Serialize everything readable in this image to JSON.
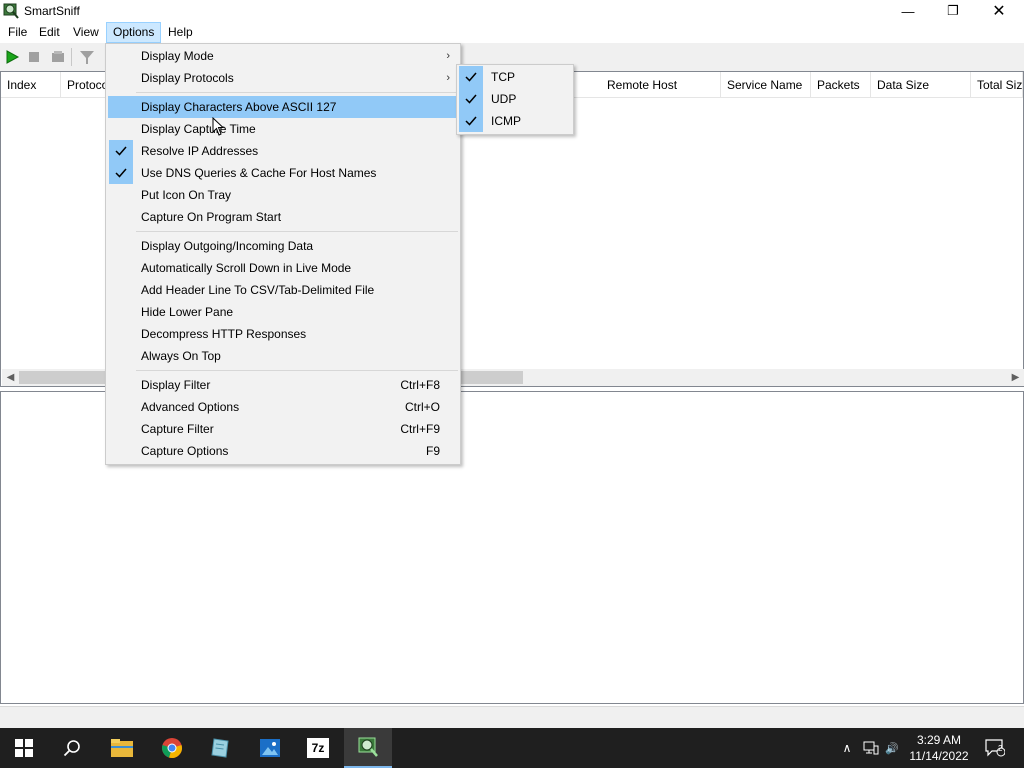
{
  "window": {
    "title": "SmartSniff",
    "minimize_glyph": "—",
    "maximize_glyph": "❐",
    "close_glyph": "✕"
  },
  "menubar": {
    "items": [
      "File",
      "Edit",
      "View",
      "Options",
      "Help"
    ],
    "active": "Options"
  },
  "toolbar": {
    "icons": [
      "play-icon",
      "stop-icon",
      "clear-icon",
      "filter-icon"
    ]
  },
  "columns": [
    {
      "label": "Index"
    },
    {
      "label": "Protocol"
    },
    {
      "label": "Remote Host"
    },
    {
      "label": "Service Name"
    },
    {
      "label": "Packets"
    },
    {
      "label": "Data Size"
    },
    {
      "label": "Total Size"
    }
  ],
  "options_menu": {
    "group1": [
      {
        "label": "Display Mode",
        "has_submenu": true
      },
      {
        "label": "Display Protocols",
        "has_submenu": true
      }
    ],
    "group2": [
      {
        "label": "Display Characters Above ASCII 127",
        "highlighted": true,
        "checked": false
      },
      {
        "label": "Display Capture Time",
        "checked": false
      },
      {
        "label": "Resolve IP Addresses",
        "checked": true
      },
      {
        "label": "Use DNS Queries & Cache For Host Names",
        "checked": true
      },
      {
        "label": "Put Icon On Tray",
        "checked": false
      },
      {
        "label": "Capture On Program Start",
        "checked": false
      }
    ],
    "group3": [
      {
        "label": "Display Outgoing/Incoming Data"
      },
      {
        "label": "Automatically Scroll Down in Live Mode"
      },
      {
        "label": "Add Header Line To CSV/Tab-Delimited File"
      },
      {
        "label": "Hide Lower Pane"
      },
      {
        "label": "Decompress HTTP Responses"
      },
      {
        "label": "Always On Top"
      }
    ],
    "group4": [
      {
        "label": "Display Filter",
        "shortcut": "Ctrl+F8"
      },
      {
        "label": "Advanced Options",
        "shortcut": "Ctrl+O"
      },
      {
        "label": "Capture Filter",
        "shortcut": "Ctrl+F9"
      },
      {
        "label": "Capture Options",
        "shortcut": "F9"
      }
    ]
  },
  "protocols_submenu": [
    {
      "label": "TCP",
      "checked": true
    },
    {
      "label": "UDP",
      "checked": true
    },
    {
      "label": "ICMP",
      "checked": true
    }
  ],
  "taskbar": {
    "apps": [
      "start-icon",
      "search-icon",
      "file-explorer-icon",
      "chrome-icon",
      "notepad-icon",
      "photos-icon",
      "7zip-icon",
      "smartsniff-icon"
    ],
    "active_app": "smartsniff-icon",
    "seven_zip_label": "7z",
    "tray_chevron": "∧",
    "tray_volume": "🔊",
    "time": "3:29 AM",
    "date": "11/14/2022",
    "notification_count": "2"
  },
  "colors": {
    "menu_highlight": "#91c9f7",
    "menubar_active": "#cce8ff",
    "taskbar": "#1f1f1f",
    "play_green": "#1aa51a"
  }
}
